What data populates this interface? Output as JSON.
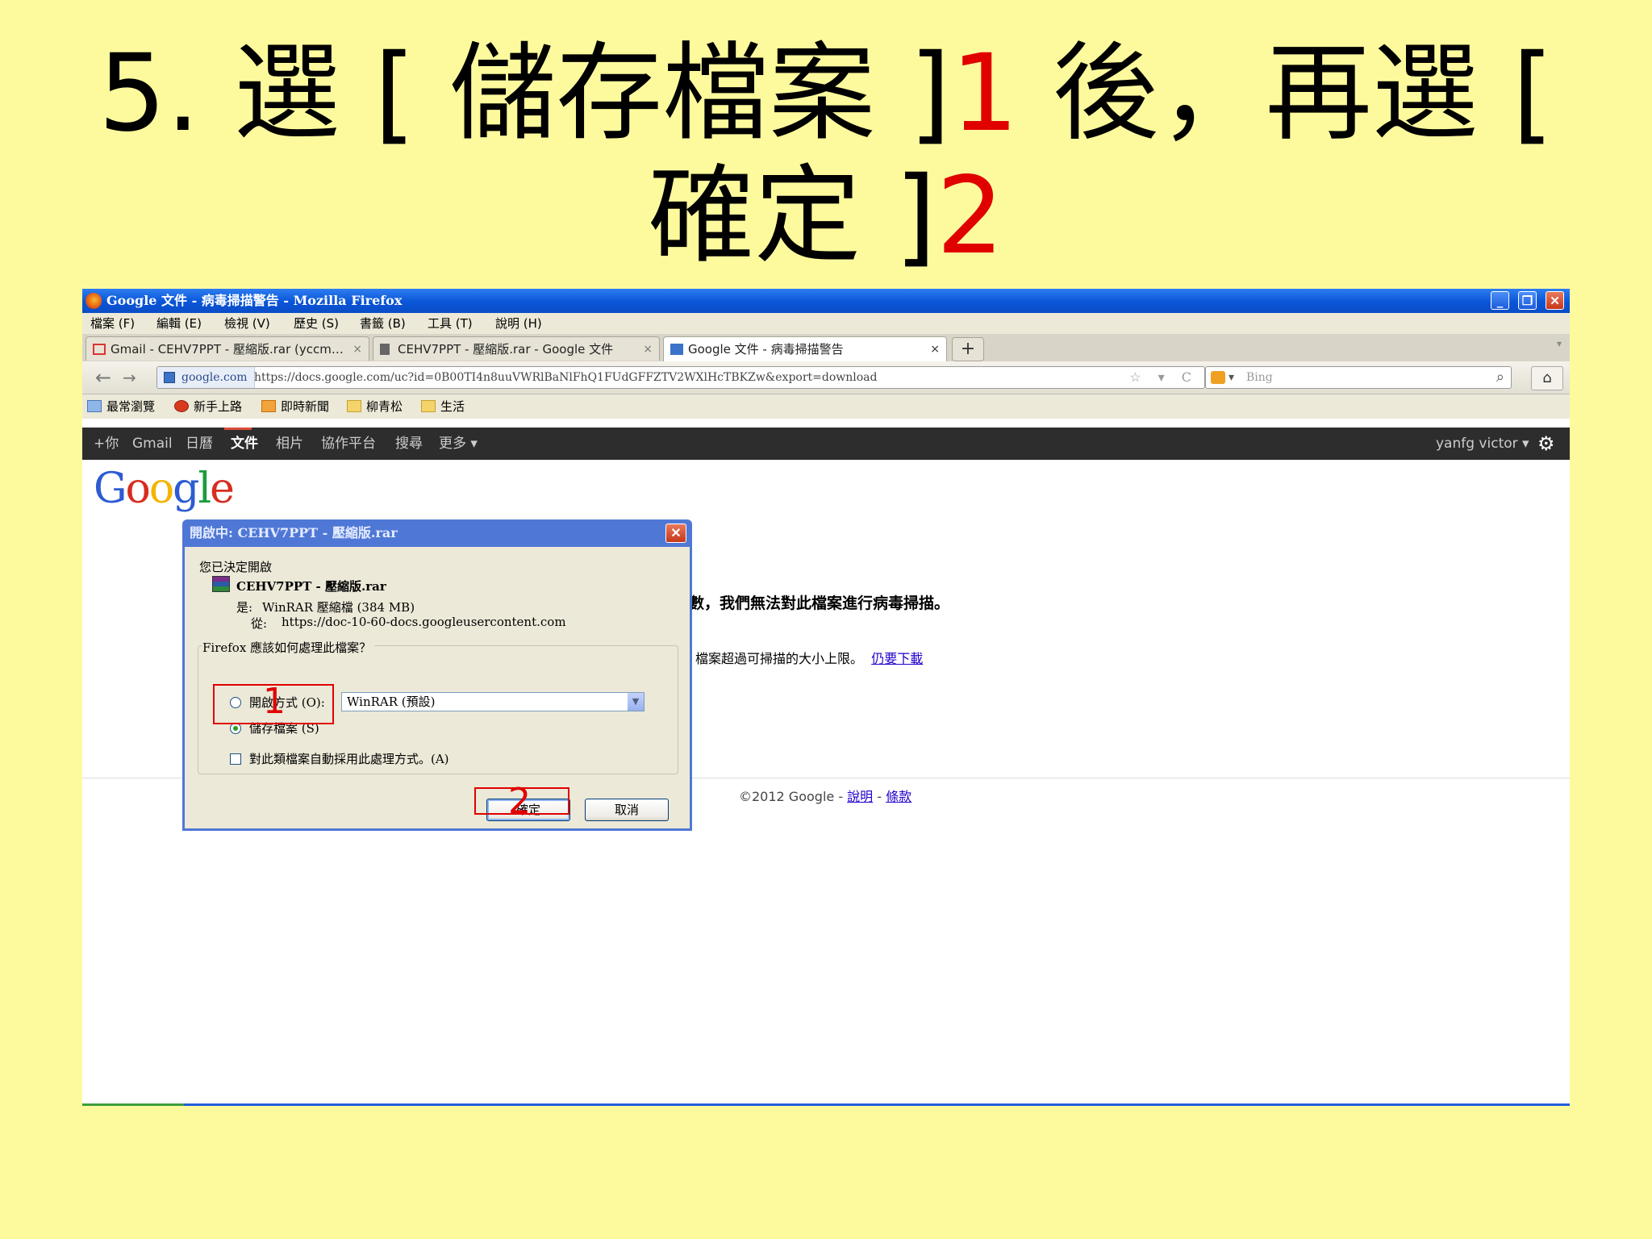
{
  "slide": {
    "title_prefix": "5. 選 [ 儲存檔案 ]",
    "title_num1": "1",
    "title_mid": " 後，再選 [ 確定 ]",
    "title_num2": "2"
  },
  "window": {
    "title": "Google 文件 - 病毒掃描警告 - Mozilla Firefox",
    "controls": {
      "minimize": "_",
      "maximize": "❐",
      "close": "✕"
    }
  },
  "menubar": [
    "檔案 (F)",
    "編輯 (E)",
    "檢視 (V)",
    "歷史 (S)",
    "書籤 (B)",
    "工具 (T)",
    "說明 (H)"
  ],
  "tabs": [
    {
      "label": "Gmail - CEHV7PPT - 壓縮版.rar (yccm…",
      "icon": "gmail-icon"
    },
    {
      "label": "CEHV7PPT - 壓縮版.rar - Google 文件",
      "icon": "document-icon"
    },
    {
      "label": "Google 文件 - 病毒掃描警告",
      "icon": "google-docs-icon"
    }
  ],
  "navbar": {
    "back": "←",
    "forward": "→",
    "site_identity": "google.com",
    "url": "https://docs.google.com/uc?id=0B00TI4n8uuVWRlBaNlFhQ1FUdGFFZTV2WXlHcTBKZw&export=download",
    "url_tools": "☆ ▾ C",
    "search_placeholder": "Bing",
    "search_dropdown": "▾",
    "search_icon": "⌕",
    "home_icon": "⌂"
  },
  "bookmarks": [
    "最常瀏覽",
    "新手上路",
    "即時新聞",
    "柳青松",
    "生活"
  ],
  "google_bar": {
    "items": [
      "+你",
      "Gmail",
      "日曆",
      "文件",
      "相片",
      "協作平台",
      "搜尋",
      "更多 ▾"
    ],
    "user": "yanfg victor ▾",
    "gear": "⚙"
  },
  "page": {
    "logo": "Google",
    "message_bold": "數，我們無法對此檔案進行病毒掃描。",
    "message_small": "檔案超過可掃描的大小上限。",
    "download_link": "仍要下載",
    "footer_copyright": "©2012 Google - ",
    "footer_help": "說明",
    "footer_sep": " - ",
    "footer_terms": "條款"
  },
  "dialog": {
    "title": "開啟中: CEHV7PPT - 壓縮版.rar",
    "close": "✕",
    "intro": "您已決定開啟",
    "file_name": "CEHV7PPT - 壓縮版.rar",
    "type_label": "是:",
    "type_value": "WinRAR 壓縮檔 (384 MB)",
    "from_label": "從:",
    "from_value": "https://doc-10-60-docs.googleusercontent.com",
    "question": "Firefox 應該如何處理此檔案？",
    "open_with_label": "開啟方式 (O):",
    "open_with_value": "WinRAR (預設)",
    "select_arrow": "▼",
    "save_file_label": "儲存檔案 (S)",
    "auto_label": "對此類檔案自動採用此處理方式。(A)",
    "ok_label": "確定",
    "cancel_label": "取消"
  },
  "annotations": {
    "marker1": "1",
    "marker2": "2",
    "color": "#e00000"
  }
}
